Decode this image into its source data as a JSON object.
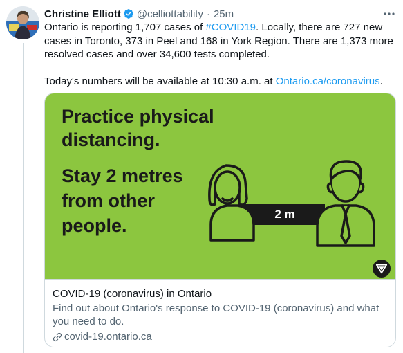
{
  "tweet": {
    "author_name": "Christine Elliott",
    "handle": "@celliottability",
    "separator": "·",
    "time": "25m",
    "more_label": "•••",
    "text_part1": "Ontario is reporting 1,707 cases of ",
    "hashtag": "#COVID19",
    "text_part2": ". Locally, there are 727 new cases in Toronto, 373 in Peel and 168 in York Region. There are 1,373 more resolved cases and over 34,600 tests completed.",
    "text2_part1": "Today's numbers will be available at 10:30 a.m. at ",
    "text2_link": "Ontario.ca/coronavirus",
    "text2_part2": "."
  },
  "card": {
    "image_heading": "Practice physical\ndistancing.",
    "image_subheading": "Stay 2 metres\nfrom other\npeople.",
    "distance_label": "2 m",
    "title": "COVID-19 (coronavirus) in Ontario",
    "description": "Find out about Ontario's response to COVID-19 (coronavirus) and what you need to do.",
    "domain": "covid-19.ontario.ca"
  },
  "colors": {
    "accent": "#1d9bf0",
    "card_green": "#8cc63f",
    "muted": "#536471"
  },
  "icons": [
    "verified-icon",
    "more-icon",
    "link-icon",
    "trillium-logo-icon"
  ]
}
